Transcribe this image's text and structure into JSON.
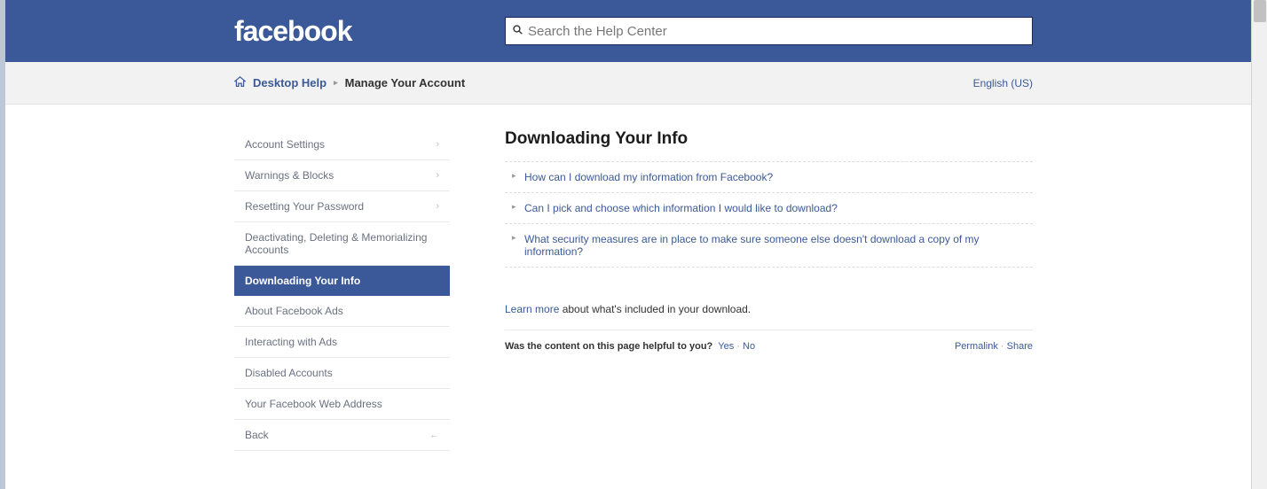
{
  "header": {
    "logo_text": "facebook",
    "search_placeholder": "Search the Help Center"
  },
  "breadcrumb": {
    "home_link": "Desktop Help",
    "current": "Manage Your Account",
    "language": "English (US)"
  },
  "sidebar": {
    "items": [
      {
        "label": "Account Settings",
        "has_chevron": true
      },
      {
        "label": "Warnings & Blocks",
        "has_chevron": true
      },
      {
        "label": "Resetting Your Password",
        "has_chevron": true
      },
      {
        "label": "Deactivating, Deleting & Memorializing Accounts",
        "has_chevron": false
      },
      {
        "label": "Downloading Your Info",
        "has_chevron": false,
        "active": true
      },
      {
        "label": "About Facebook Ads",
        "has_chevron": false
      },
      {
        "label": "Interacting with Ads",
        "has_chevron": false
      },
      {
        "label": "Disabled Accounts",
        "has_chevron": false
      },
      {
        "label": "Your Facebook Web Address",
        "has_chevron": false
      },
      {
        "label": "Back",
        "has_back": true
      }
    ]
  },
  "main": {
    "title": "Downloading Your Info",
    "faqs": [
      "How can I download my information from Facebook?",
      "Can I pick and choose which information I would like to download?",
      "What security measures are in place to make sure someone else doesn't download a copy of my information?"
    ],
    "learn_more_link": "Learn more",
    "learn_more_rest": " about what's included in your download.",
    "feedback_question": "Was the content on this page helpful to you?",
    "feedback_yes": "Yes",
    "feedback_no": "No",
    "permalink": "Permalink",
    "share": "Share"
  }
}
